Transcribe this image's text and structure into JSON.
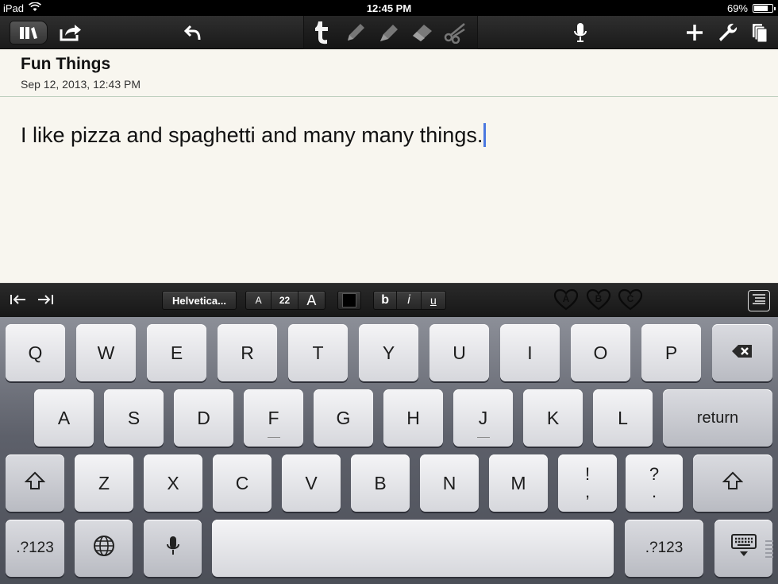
{
  "status_bar": {
    "device": "iPad",
    "time": "12:45 PM",
    "battery": "69%",
    "battery_level": 0.69
  },
  "toolbar": {
    "icons": [
      "library-icon",
      "share-icon",
      "undo-icon",
      "text-tool-icon",
      "pen-icon",
      "highlighter-icon",
      "eraser-icon",
      "scissors-icon",
      "microphone-icon",
      "add-icon",
      "wrench-icon",
      "pages-icon"
    ]
  },
  "document": {
    "title": "Fun Things",
    "date": "Sep 12, 2013, 12:43 PM",
    "body": "I like pizza and spaghetti and many many things."
  },
  "format_bar": {
    "font": "Helvetica...",
    "size_small": "A",
    "size": "22",
    "size_large": "A",
    "bold": "b",
    "italic": "i",
    "underline": "u",
    "color": "#000000",
    "presets": [
      "A",
      "B",
      "C"
    ]
  },
  "keyboard": {
    "row1": [
      "Q",
      "W",
      "E",
      "R",
      "T",
      "Y",
      "U",
      "I",
      "O",
      "P"
    ],
    "row2": [
      "A",
      "S",
      "D",
      "F",
      "G",
      "H",
      "J",
      "K",
      "L"
    ],
    "return": "return",
    "row3": [
      "Z",
      "X",
      "C",
      "V",
      "B",
      "N",
      "M"
    ],
    "exclaim_top": "!",
    "exclaim_bottom": ",",
    "question_top": "?",
    "question_bottom": ".",
    "numbers_left": ".?123",
    "numbers_right": ".?123"
  }
}
